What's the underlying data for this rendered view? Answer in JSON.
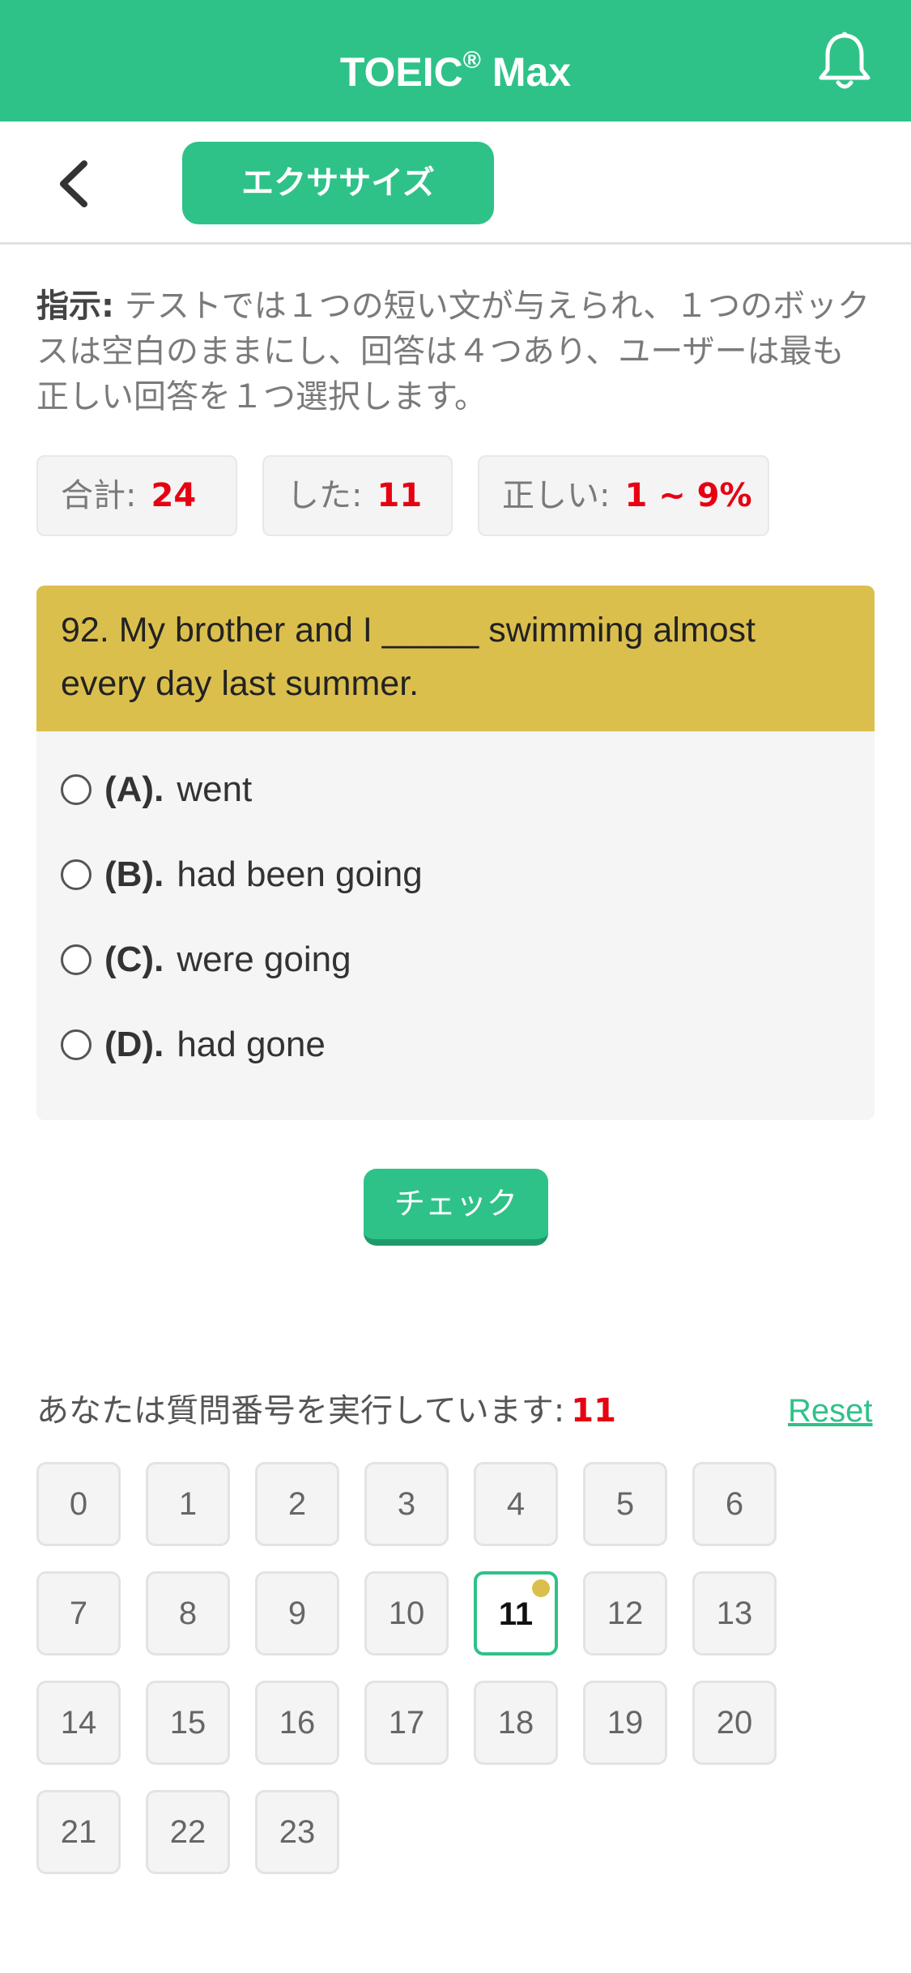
{
  "app": {
    "title": "TOEIC",
    "title_mark": "®",
    "title_suffix": "Max",
    "accent_color": "#2ec288",
    "header_icon": "bell-icon"
  },
  "topbar": {
    "back_icon": "chevron-left-icon",
    "exercise_label": "エクササイズ"
  },
  "instructions": {
    "label": "指示:",
    "text": " テストでは１つの短い文が与えられ、１つのボックスは空白のままにし、回答は４つあり、ユーザーは最も正しい回答を１つ選択します。"
  },
  "stats": {
    "total_label": "合計:",
    "total_value": "24",
    "done_label": "した:",
    "done_value": "11",
    "correct_label": "正しい:",
    "correct_value": "1 ~ 9%"
  },
  "question": {
    "text": "92. My brother and I _____ swimming almost every day last summer.",
    "options": [
      {
        "letter": "(A).",
        "text": "went"
      },
      {
        "letter": "(B).",
        "text": "had been going"
      },
      {
        "letter": "(C).",
        "text": "were going"
      },
      {
        "letter": "(D).",
        "text": "had gone"
      }
    ]
  },
  "check_label": "チェック",
  "progress": {
    "running_label": "あなたは質問番号を実行しています:",
    "current": "11",
    "reset_label": "Reset",
    "numbers": [
      "0",
      "1",
      "2",
      "3",
      "4",
      "5",
      "6",
      "7",
      "8",
      "9",
      "10",
      "11",
      "12",
      "13",
      "14",
      "15",
      "16",
      "17",
      "18",
      "19",
      "20",
      "21",
      "22",
      "23"
    ]
  }
}
